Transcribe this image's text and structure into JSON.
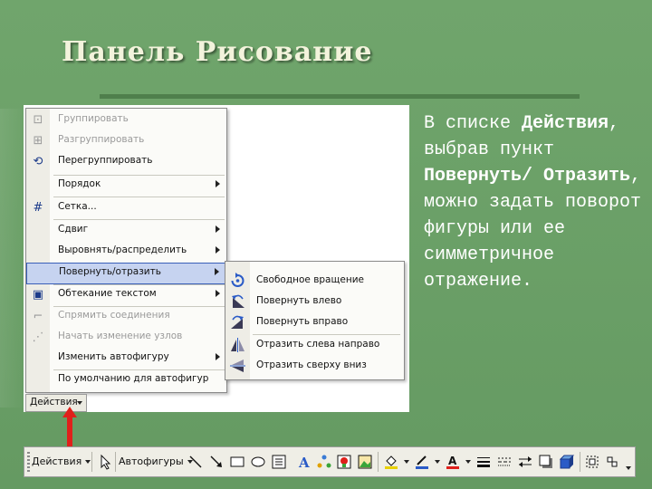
{
  "slide": {
    "title": "Панель Рисование",
    "description": {
      "p1": "В списке ",
      "b1": "Действия",
      "p2": ", выбрав пункт ",
      "b2": "Повернуть/ Отразить",
      "p3": ", можно задать поворот фигуры или ее симметричное отражение."
    }
  },
  "menu": {
    "items": [
      {
        "label": "Группировать",
        "icon": "group-icon",
        "disabled": true
      },
      {
        "label": "Разгруппировать",
        "icon": "ungroup-icon",
        "disabled": true
      },
      {
        "label": "Перегруппировать",
        "icon": "regroup-icon",
        "disabled": false
      },
      {
        "label": "Порядок",
        "submenu": true
      },
      {
        "label": "Сетка...",
        "icon": "grid-icon"
      },
      {
        "label": "Сдвиг",
        "submenu": true
      },
      {
        "label": "Выровнять/распределить",
        "submenu": true
      },
      {
        "label": "Повернуть/отразить",
        "submenu": true,
        "highlighted": true
      },
      {
        "label": "Обтекание текстом",
        "icon": "text-wrap-icon",
        "submenu": true
      },
      {
        "label": "Спрямить соединения",
        "icon": "connector-icon",
        "disabled": true
      },
      {
        "label": "Начать изменение узлов",
        "icon": "edit-points-icon",
        "disabled": true
      },
      {
        "label": "Изменить автофигуру",
        "submenu": true
      },
      {
        "label": "По умолчанию для автофигур"
      }
    ],
    "actions_button": "Действия"
  },
  "submenu": {
    "items": [
      {
        "label": "Свободное вращение",
        "icon": "free-rotate-icon"
      },
      {
        "label": "Повернуть влево",
        "icon": "rotate-left-icon"
      },
      {
        "label": "Повернуть вправо",
        "icon": "rotate-right-icon"
      },
      {
        "label": "Отразить слева направо",
        "icon": "flip-horizontal-icon"
      },
      {
        "label": "Отразить сверху вниз",
        "icon": "flip-vertical-icon"
      }
    ]
  },
  "toolbar": {
    "actions_label": "Действия",
    "autoshapes_label": "Автофигуры",
    "icons": [
      "select-arrow-icon",
      "line-icon",
      "arrow-icon",
      "rectangle-icon",
      "oval-icon",
      "textbox-icon",
      "wordart-icon",
      "diagram-icon",
      "clipart-icon",
      "picture-icon",
      "fill-color-icon",
      "line-color-icon",
      "font-color-icon",
      "line-style-icon",
      "dash-style-icon",
      "arrow-style-icon",
      "shadow-icon",
      "3d-icon"
    ]
  },
  "colors": {
    "slide_background": "#6b9e68",
    "title_text": "#f3f3dc",
    "highlight": "#c6d3f0",
    "pointer_arrow": "#e0201b"
  }
}
